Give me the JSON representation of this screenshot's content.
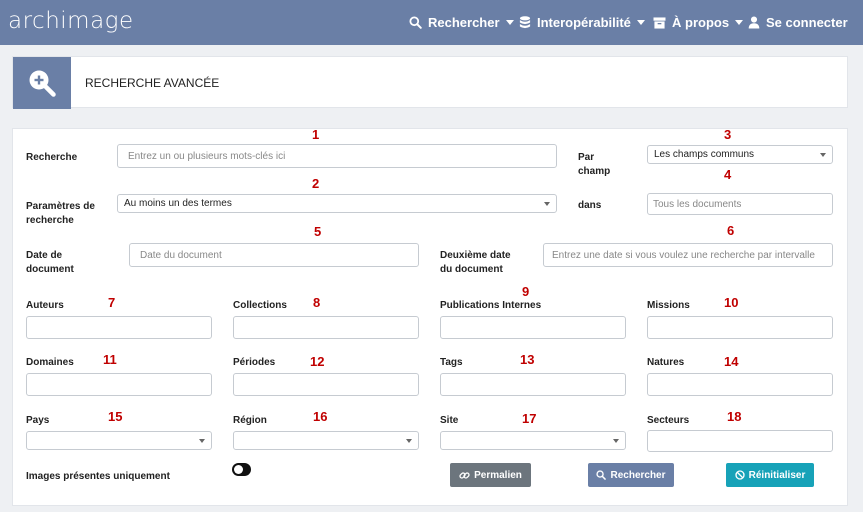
{
  "app": {
    "logo": "archimage"
  },
  "nav": {
    "search": "Rechercher",
    "interop": "Interopérabilité",
    "about": "À propos",
    "login": "Se connecter"
  },
  "header": {
    "title": "RECHERCHE AVANCÉE"
  },
  "form": {
    "recherche": {
      "label": "Recherche",
      "placeholder": "Entrez un ou plusieurs mots-clés ici",
      "num": "1"
    },
    "parametres": {
      "label_l1": "Paramètres de",
      "label_l2": "recherche",
      "value": "Au moins un des termes",
      "num": "2"
    },
    "par_champ": {
      "label_l1": "Par",
      "label_l2": "champ",
      "value": "Les champs communs",
      "num": "3"
    },
    "dans": {
      "label": "dans",
      "placeholder": "Tous les documents",
      "num": "4"
    },
    "date_doc": {
      "label_l1": "Date de",
      "label_l2": "document",
      "placeholder": "Date du document",
      "num": "5"
    },
    "date2": {
      "label_l1": "Deuxième date",
      "label_l2": "du document",
      "placeholder": "Entrez une date si vous voulez une recherche par intervalle",
      "num": "6"
    },
    "auteurs": {
      "label": "Auteurs",
      "num": "7"
    },
    "collections": {
      "label": "Collections",
      "num": "8"
    },
    "publications": {
      "label": "Publications Internes",
      "num": "9"
    },
    "missions": {
      "label": "Missions",
      "num": "10"
    },
    "domaines": {
      "label": "Domaines",
      "num": "11"
    },
    "periodes": {
      "label": "Périodes",
      "num": "12"
    },
    "tags": {
      "label": "Tags",
      "num": "13"
    },
    "natures": {
      "label": "Natures",
      "num": "14"
    },
    "pays": {
      "label": "Pays",
      "num": "15"
    },
    "region": {
      "label": "Région",
      "num": "16"
    },
    "site": {
      "label": "Site",
      "num": "17"
    },
    "secteurs": {
      "label": "Secteurs",
      "num": "18"
    },
    "images_only": {
      "label": "Images présentes uniquement"
    }
  },
  "buttons": {
    "permalien": "Permalien",
    "rechercher": "Rechercher",
    "reinitialiser": "Réinitialiser"
  },
  "colors": {
    "navbar": "#6a7fa6",
    "annotation": "#c00000",
    "btn_permalien": "#6c757d",
    "btn_rechercher": "#6a7fa6",
    "btn_reinitialiser": "#17a2b8"
  }
}
